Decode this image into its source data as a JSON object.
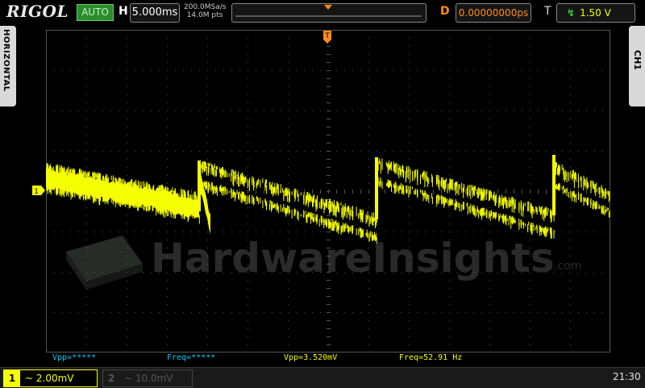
{
  "header": {
    "brand": "RIGOL",
    "run_status": "AUTO",
    "horizontal_label": "H",
    "timebase": "5.000ms",
    "sample_rate": "200.0MSa/s",
    "memory_depth": "14.0M pts",
    "delay_label": "D",
    "delay_value": "0.00000000ps",
    "trigger_label": "T",
    "trigger_level": "1.50 V",
    "trigger_marker": "T"
  },
  "side_tabs": {
    "left": "HORIZONTAL",
    "right": "CH1"
  },
  "screen": {
    "channel_marker": "1",
    "watermark": "HardwareInsights",
    "watermark_suffix": ".com"
  },
  "measurements": [
    {
      "text": "Vpp=*****",
      "color": "#00ccff"
    },
    {
      "text": "Freq=*****",
      "color": "#00ccff"
    },
    {
      "text": "Vpp=3.520mV",
      "color": "#f6ff00"
    },
    {
      "text": "Freq=52.91 Hz",
      "color": "#f6ff00"
    }
  ],
  "footer": {
    "ch1_number": "1",
    "ch1_scale": "~ 2.00mV",
    "ch2_number": "2",
    "ch2_scale": "~ 10.0mV",
    "clock": "21:30"
  },
  "colors": {
    "ch1": "#f6ff00",
    "trigger": "#ff8c1a",
    "status": "#2e8b2e",
    "grid": "#555555"
  }
}
